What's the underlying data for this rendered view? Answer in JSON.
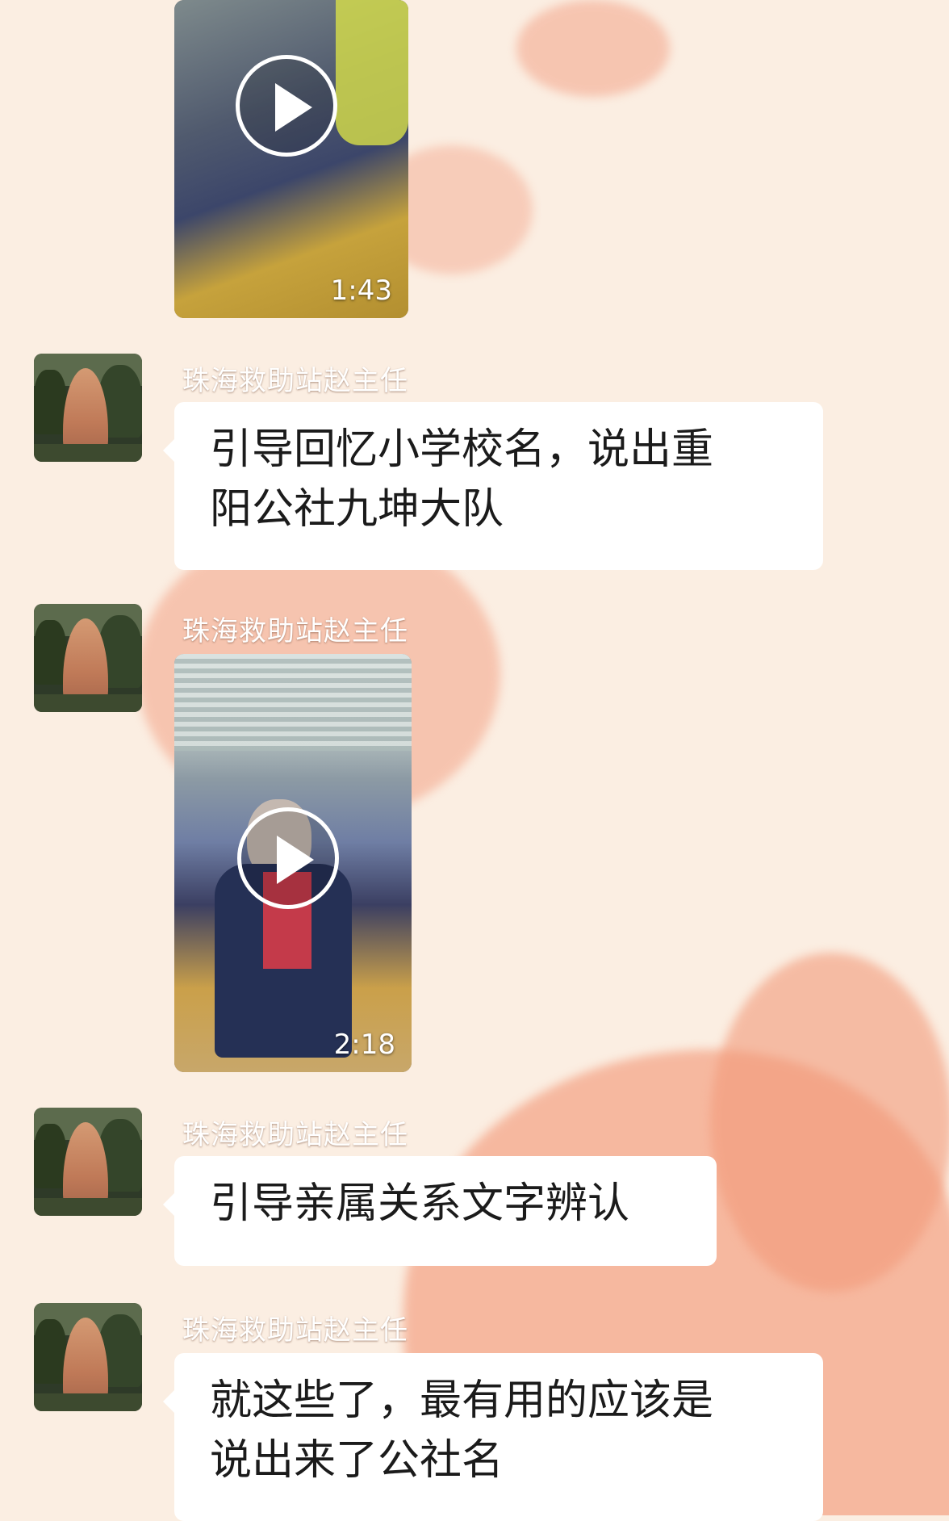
{
  "theme": {
    "bubble_color": "#ffffff",
    "background_color": "#fbeee2",
    "accent_heart": "#f3a489"
  },
  "messages": [
    {
      "type": "video",
      "duration": "1:43",
      "icon": "play-icon"
    },
    {
      "type": "text",
      "sender": "珠海救助站赵主任",
      "lines": [
        "引导回忆小学校名，说出重",
        "阳公社九坤大队"
      ]
    },
    {
      "type": "video",
      "sender": "珠海救助站赵主任",
      "duration": "2:18",
      "icon": "play-icon"
    },
    {
      "type": "text",
      "sender": "珠海救助站赵主任",
      "lines": [
        "引导亲属关系文字辨认"
      ]
    },
    {
      "type": "text",
      "sender": "珠海救助站赵主任",
      "lines": [
        "就这些了，最有用的应该是",
        "说出来了公社名"
      ]
    }
  ]
}
